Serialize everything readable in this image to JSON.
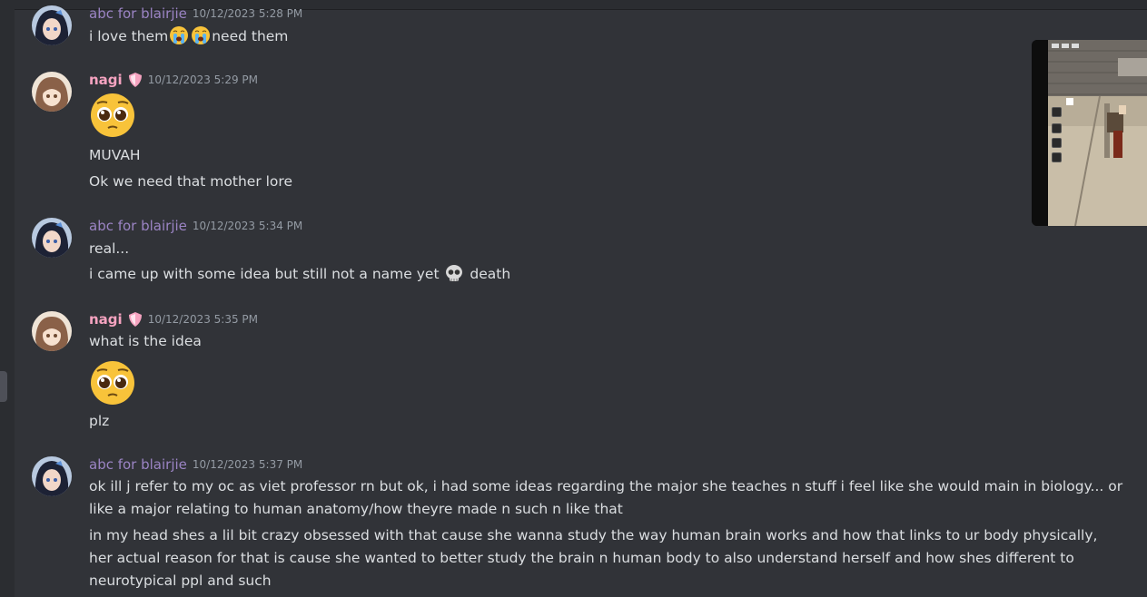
{
  "messages": [
    {
      "author": "abc for blairjie",
      "timestamp": "10/12/2023 5:28 PM",
      "lines": [
        {
          "before": "i love them",
          "after": "need them"
        }
      ]
    },
    {
      "author": "nagi",
      "timestamp": "10/12/2023 5:29 PM",
      "lines": [
        "MUVAH",
        "Ok we need that mother lore"
      ]
    },
    {
      "author": "abc for blairjie",
      "timestamp": "10/12/2023 5:34 PM",
      "lines": [
        "real...",
        {
          "before": "i came up with some idea but still not a name yet",
          "after": "death"
        }
      ]
    },
    {
      "author": "nagi",
      "timestamp": "10/12/2023 5:35 PM",
      "lines": [
        "what is the idea",
        "plz"
      ]
    },
    {
      "author": "abc for blairjie",
      "timestamp": "10/12/2023 5:37 PM",
      "lines": [
        "ok ill j refer to my oc as viet professor rn but ok, i had some ideas regarding the major she teaches n stuff i feel like she would main in biology... or like a major relating to human anatomy/how theyre made n such n like that",
        "in my head shes a lil bit crazy obsessed with that cause she wanna study the way human brain works and how that links to ur body physically, her actual reason for that is cause she wanted to better study the brain n human body to also understand herself and how shes different to neurotypical ppl and such"
      ]
    }
  ],
  "colors": {
    "background": "#313338",
    "abc_name": "#9b84c4",
    "nagi_name": "#f5a3c0",
    "timestamp": "#949ba4",
    "text": "#dbdee1"
  },
  "icons": {
    "crying": "loudly-crying-face-emoji",
    "pleading": "pleading-face-emoji",
    "skull": "skull-emoji",
    "badge": "shield-badge-icon"
  }
}
